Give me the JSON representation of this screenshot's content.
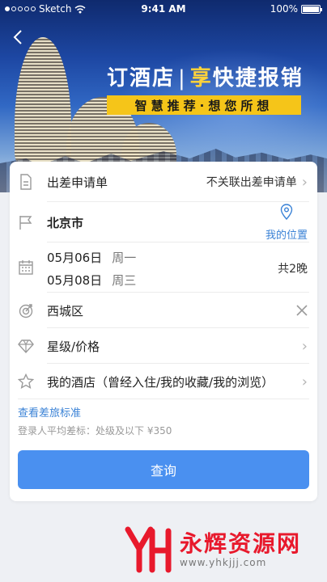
{
  "status_bar": {
    "carrier": "Sketch",
    "time": "9:41 AM",
    "battery": "100%",
    "battery_level": 1.0
  },
  "banner": {
    "title_left": "订酒店",
    "divider": "|",
    "title_accent": "享",
    "title_right": "快捷报销",
    "subtitle": "智慧推荐·想您所想"
  },
  "form": {
    "trip_application": {
      "label": "出差申请单",
      "value": "不关联出差申请单"
    },
    "city": {
      "label": "北京市",
      "my_location": "我的位置"
    },
    "dates": {
      "checkin_date": "05月06日",
      "checkin_weekday": "周一",
      "checkout_date": "05月08日",
      "checkout_weekday": "周三",
      "nights": "共2晚"
    },
    "district": {
      "label": "西城区"
    },
    "star_price": {
      "label": "星级/价格"
    },
    "my_hotels": {
      "label": "我的酒店（曾经入住/我的收藏/我的浏览）"
    },
    "standard_link": "查看差旅标准",
    "standard_note": "登录人平均差标：处级及以下 ¥350",
    "search_button": "查询"
  },
  "watermark": {
    "title": "永辉资源网",
    "url": "www.yhkjjj.com"
  },
  "colors": {
    "accent_blue": "#3a82d6",
    "button_blue": "#4a90f0",
    "banner_yellow": "#f5c519",
    "watermark_red": "#e8192c"
  }
}
